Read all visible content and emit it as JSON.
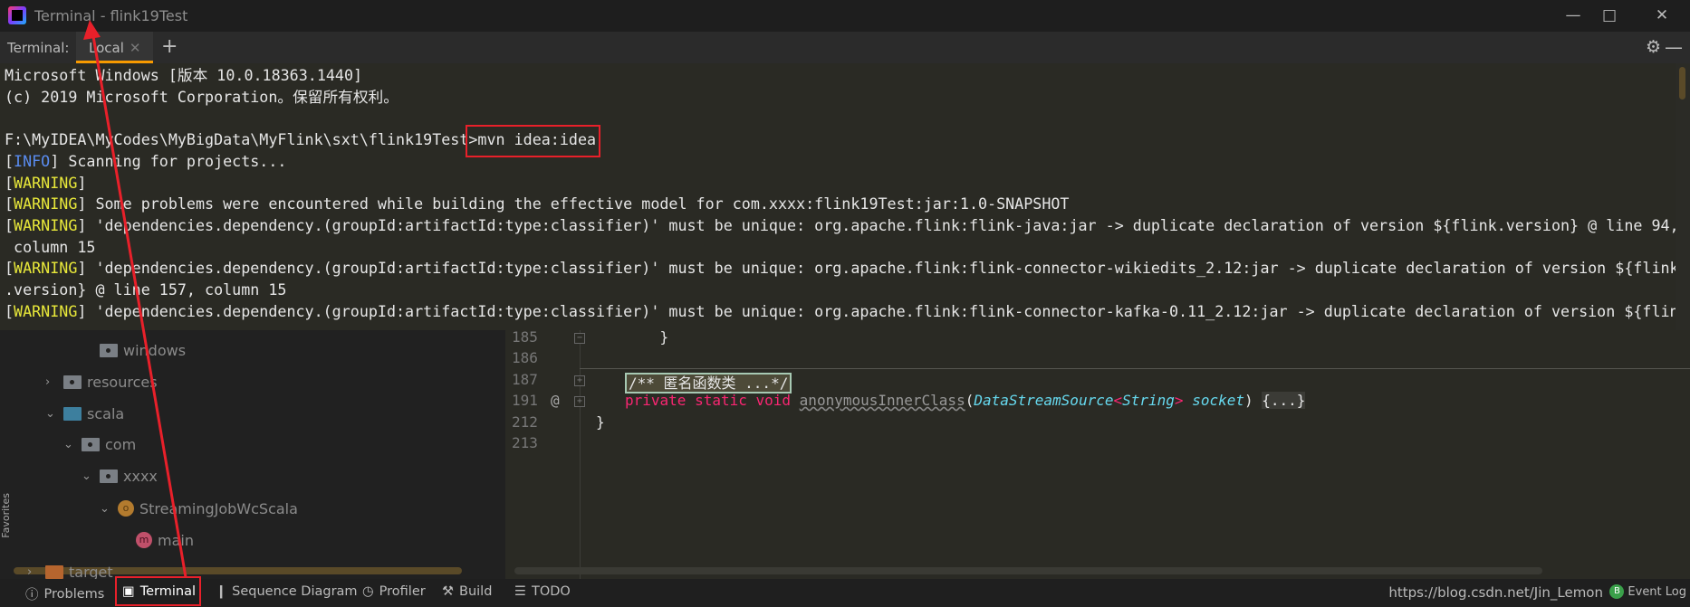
{
  "window": {
    "title": "Terminal - flink19Test",
    "controls": [
      "minimize",
      "maximize",
      "close"
    ]
  },
  "tabbar": {
    "label": "Terminal:",
    "tabs": [
      {
        "label": "Local",
        "active": true
      }
    ],
    "add_label": "+"
  },
  "terminal": {
    "lines": [
      [
        {
          "t": "Microsoft Windows [版本 10.0.18363.1440]"
        }
      ],
      [
        {
          "t": "(c) 2019 Microsoft Corporation。保留所有权利。"
        }
      ],
      [
        {
          "t": ""
        }
      ],
      [
        {
          "t": "F:\\MyIDEA\\MyCodes\\MyBigData\\MyFlink\\sxt\\flink19Test>mvn idea:idea"
        }
      ],
      [
        {
          "t": "["
        },
        {
          "t": "INFO",
          "c": "i"
        },
        {
          "t": "] Scanning for projects..."
        }
      ],
      [
        {
          "t": "["
        },
        {
          "t": "WARNING",
          "c": "w"
        },
        {
          "t": "]"
        }
      ],
      [
        {
          "t": "["
        },
        {
          "t": "WARNING",
          "c": "w"
        },
        {
          "t": "] Some problems were encountered while building the effective model for com.xxxx:flink19Test:jar:1.0-SNAPSHOT"
        }
      ],
      [
        {
          "t": "["
        },
        {
          "t": "WARNING",
          "c": "w"
        },
        {
          "t": "] 'dependencies.dependency.(groupId:artifactId:type:classifier)' must be unique: org.apache.flink:flink-java:jar -> duplicate declaration of version ${flink.version} @ line 94,"
        }
      ],
      [
        {
          "t": " column 15"
        }
      ],
      [
        {
          "t": "["
        },
        {
          "t": "WARNING",
          "c": "w"
        },
        {
          "t": "] 'dependencies.dependency.(groupId:artifactId:type:classifier)' must be unique: org.apache.flink:flink-connector-wikiedits_2.12:jar -> duplicate declaration of version ${flink"
        }
      ],
      [
        {
          "t": ".version} @ line 157, column 15"
        }
      ],
      [
        {
          "t": "["
        },
        {
          "t": "WARNING",
          "c": "w"
        },
        {
          "t": "] 'dependencies.dependency.(groupId:artifactId:type:classifier)' must be unique: org.apache.flink:flink-connector-kafka-0.11_2.12:jar -> duplicate declaration of version ${flin"
        }
      ]
    ]
  },
  "tree": {
    "items": [
      {
        "label": "windows",
        "icon": "package-folder",
        "depth": 4,
        "chevron": ""
      },
      {
        "label": "resources",
        "icon": "resources-folder",
        "depth": 2,
        "chevron": "collapsed"
      },
      {
        "label": "scala",
        "icon": "source-folder",
        "depth": 2,
        "chevron": "expanded"
      },
      {
        "label": "com",
        "icon": "package-folder",
        "depth": 3,
        "chevron": "expanded"
      },
      {
        "label": "xxxx",
        "icon": "package-folder",
        "depth": 4,
        "chevron": "expanded"
      },
      {
        "label": "StreamingJobWcScala",
        "icon": "scala-object",
        "depth": 5,
        "chevron": "expanded"
      },
      {
        "label": "main",
        "icon": "method",
        "depth": 6,
        "chevron": ""
      },
      {
        "label": "target",
        "icon": "excluded-folder",
        "depth": 1,
        "chevron": "collapsed"
      }
    ],
    "favorites_label": "Favorites"
  },
  "editor": {
    "lines": [
      {
        "n": "185",
        "code": "    }"
      },
      {
        "n": "186",
        "code": ""
      },
      {
        "n": "187",
        "comment": "/** 匿名函数类 ...*/"
      },
      {
        "n": "191",
        "mods": "private static void",
        "method": "anonymousInnerClass",
        "type": "DataStreamSource",
        "generic": "String",
        "param": "socket",
        "body": "{...}"
      },
      {
        "n": "212",
        "code": "}"
      },
      {
        "n": "213",
        "code": ""
      }
    ]
  },
  "bottombar": {
    "items": [
      {
        "label": "Problems",
        "icon": "problems-icon"
      },
      {
        "label": "Terminal",
        "icon": "terminal-icon"
      },
      {
        "label": "Sequence Diagram",
        "icon": "sequence-diagram-icon"
      },
      {
        "label": "Profiler",
        "icon": "profiler-icon"
      },
      {
        "label": "Build",
        "icon": "build-icon"
      },
      {
        "label": "TODO",
        "icon": "todo-icon"
      }
    ],
    "watermark": "https://blog.csdn.net/Jin_Lemon",
    "event_log": "Event Log"
  },
  "colors": {
    "accent": "#f79a00",
    "warning": "#e8e83a",
    "info": "#5a8cf0",
    "annotation": "#e8202a",
    "keyword": "#f92672",
    "type": "#66d9ef"
  }
}
